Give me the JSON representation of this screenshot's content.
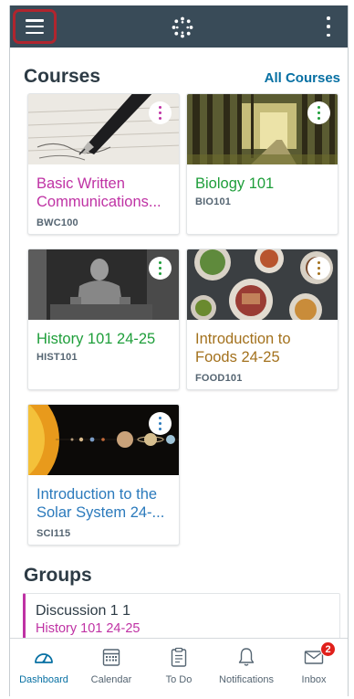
{
  "app": {
    "brand_color": "#394b58",
    "accent_color": "#0770a3"
  },
  "header": {
    "menu_icon": "hamburger-menu-icon",
    "logo_icon": "canvas-logo-icon",
    "more_icon": "kebab-menu-icon"
  },
  "courses": {
    "title": "Courses",
    "all_link": "All Courses",
    "items": [
      {
        "name": "Basic Written Communications...",
        "code": "BWC100",
        "color": "#bf32a4",
        "image": "fountain-pen-writing"
      },
      {
        "name": "Biology 101",
        "code": "BIO101",
        "color": "#1e9e3a",
        "image": "forest-path"
      },
      {
        "name": "History 101 24-25",
        "code": "HIST101",
        "color": "#1e9e3a",
        "image": "lincoln-memorial"
      },
      {
        "name": "Introduction to Foods 24-25",
        "code": "FOOD101",
        "color": "#a3711d",
        "image": "food-plates"
      },
      {
        "name": "Introduction to the Solar System  24-...",
        "code": "SCI115",
        "color": "#2b7abc",
        "image": "solar-system"
      }
    ]
  },
  "groups": {
    "title": "Groups",
    "items": [
      {
        "name": "Discussion 1 1",
        "course": "History 101 24-25"
      }
    ]
  },
  "tabbar": {
    "items": [
      {
        "label": "Dashboard",
        "icon": "dashboard-icon",
        "active": true
      },
      {
        "label": "Calendar",
        "icon": "calendar-icon",
        "active": false
      },
      {
        "label": "To Do",
        "icon": "todo-clipboard-icon",
        "active": false
      },
      {
        "label": "Notifications",
        "icon": "bell-icon",
        "active": false
      },
      {
        "label": "Inbox",
        "icon": "envelope-icon",
        "active": false,
        "badge": "2"
      }
    ]
  }
}
